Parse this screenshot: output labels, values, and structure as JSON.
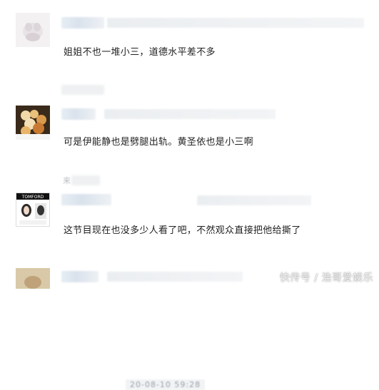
{
  "comments": [
    {
      "text": "姐姐不也一堆小三，道德水平差不多"
    },
    {
      "text": "可是伊能静也是劈腿出轨。黄圣依也是小三啊"
    },
    {
      "text": "这节目现在也没多少人看了吧，不然观众直接把他给撕了",
      "timestamp": "20-08-10 59:28",
      "avatar_brand": "TOMFORD"
    }
  ],
  "fragments": {
    "side_label": "来"
  },
  "watermark": "快传号 / 浩哥爱娱乐",
  "colors": {
    "text": "#222222",
    "blur_bar": "#e6edf4",
    "background": "#ffffff"
  },
  "icons": [
    "avatar-cat-image",
    "avatar-food-image",
    "avatar-portrait-image",
    "avatar-generic-image"
  ]
}
